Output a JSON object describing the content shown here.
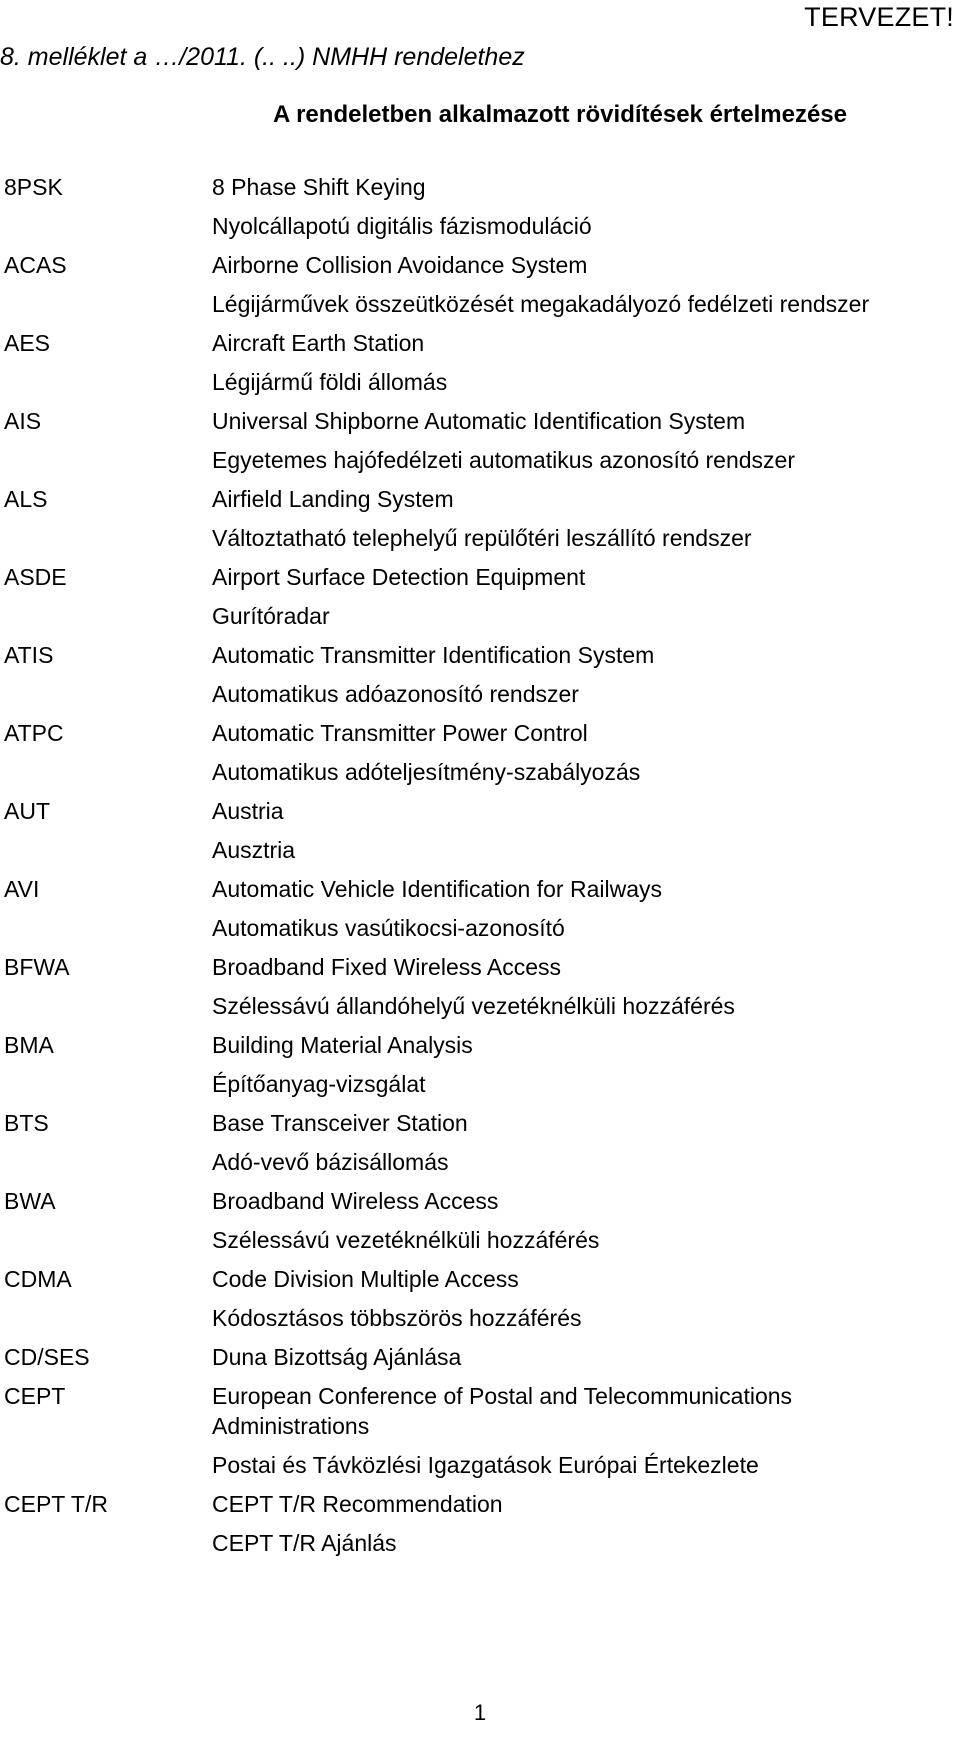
{
  "header": {
    "draft_stamp": "TERVEZET!",
    "annex_reference": "8. melléklet a …/2011. (.. ..) NMHH rendelethez",
    "title": "A rendeletben alkalmazott rövidítések értelmezése"
  },
  "footer": {
    "page_number": "1"
  },
  "abbreviations": [
    {
      "term": "8PSK",
      "definitions": [
        "8 Phase Shift Keying",
        "Nyolcállapotú digitális fázismoduláció"
      ]
    },
    {
      "term": "ACAS",
      "definitions": [
        "Airborne Collision Avoidance System",
        "Légijárművek összeütközését megakadályozó fedélzeti rendszer"
      ]
    },
    {
      "term": "AES",
      "definitions": [
        "Aircraft Earth Station",
        "Légijármű földi állomás"
      ]
    },
    {
      "term": "AIS",
      "definitions": [
        "Universal Shipborne Automatic Identification System",
        "Egyetemes hajófedélzeti automatikus azonosító rendszer"
      ]
    },
    {
      "term": "ALS",
      "definitions": [
        "Airfield Landing System",
        "Változtatható telephelyű repülőtéri leszállító rendszer"
      ]
    },
    {
      "term": "ASDE",
      "definitions": [
        "Airport Surface Detection Equipment",
        "Gurítóradar"
      ]
    },
    {
      "term": "ATIS",
      "definitions": [
        "Automatic Transmitter Identification System",
        "Automatikus adóazonosító rendszer"
      ]
    },
    {
      "term": "ATPC",
      "definitions": [
        "Automatic Transmitter Power Control",
        "Automatikus adóteljesítmény-szabályozás"
      ]
    },
    {
      "term": "AUT",
      "definitions": [
        "Austria",
        "Ausztria"
      ]
    },
    {
      "term": "AVI",
      "definitions": [
        "Automatic Vehicle Identification for Railways",
        "Automatikus vasútikocsi-azonosító"
      ]
    },
    {
      "term": "BFWA",
      "definitions": [
        "Broadband Fixed Wireless Access",
        "Szélessávú állandóhelyű vezetéknélküli hozzáférés"
      ]
    },
    {
      "term": "BMA",
      "definitions": [
        "Building Material Analysis",
        "Építőanyag-vizsgálat"
      ]
    },
    {
      "term": "BTS",
      "definitions": [
        "Base Transceiver Station",
        "Adó-vevő bázisállomás"
      ]
    },
    {
      "term": "BWA",
      "definitions": [
        "Broadband Wireless Access",
        "Szélessávú vezetéknélküli hozzáférés"
      ]
    },
    {
      "term": "CDMA",
      "definitions": [
        "Code Division Multiple Access",
        "Kódosztásos többszörös hozzáférés"
      ]
    },
    {
      "term": "CD/SES",
      "definitions": [
        "Duna Bizottság Ajánlása"
      ]
    },
    {
      "term": "CEPT",
      "wrapped_first": true,
      "definitions": [
        "European Conference of Postal and Telecommunications Administrations",
        "Postai és Távközlési Igazgatások Európai Értekezlete"
      ]
    },
    {
      "term": "CEPT T/R",
      "definitions": [
        "CEPT T/R Recommendation",
        "CEPT T/R Ajánlás"
      ]
    }
  ]
}
